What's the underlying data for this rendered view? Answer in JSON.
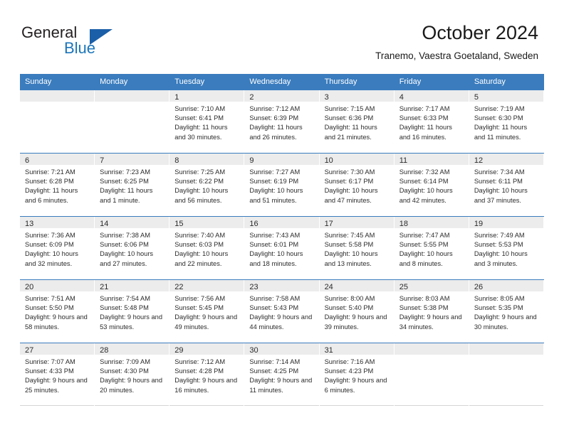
{
  "logo": {
    "primary_text": "General",
    "secondary_text": "Blue",
    "primary_color": "#231f20",
    "secondary_color": "#1b75bb",
    "triangle_color": "#1b5fa8",
    "triangle_icon": "triangle-icon"
  },
  "header": {
    "title": "October 2024",
    "subtitle": "Tranemo, Vaestra Goetaland, Sweden"
  },
  "theme": {
    "header_bg": "#3a7cbe",
    "header_text": "#ffffff",
    "day_band_bg": "#ececec",
    "row_divider": "#3a7cbe",
    "body_text": "#2b2b2b"
  },
  "weekdays": [
    "Sunday",
    "Monday",
    "Tuesday",
    "Wednesday",
    "Thursday",
    "Friday",
    "Saturday"
  ],
  "weeks": [
    [
      {
        "day": "",
        "empty": true
      },
      {
        "day": "",
        "empty": true
      },
      {
        "day": "1",
        "sunrise": "Sunrise: 7:10 AM",
        "sunset": "Sunset: 6:41 PM",
        "daylight": "Daylight: 11 hours and 30 minutes."
      },
      {
        "day": "2",
        "sunrise": "Sunrise: 7:12 AM",
        "sunset": "Sunset: 6:39 PM",
        "daylight": "Daylight: 11 hours and 26 minutes."
      },
      {
        "day": "3",
        "sunrise": "Sunrise: 7:15 AM",
        "sunset": "Sunset: 6:36 PM",
        "daylight": "Daylight: 11 hours and 21 minutes."
      },
      {
        "day": "4",
        "sunrise": "Sunrise: 7:17 AM",
        "sunset": "Sunset: 6:33 PM",
        "daylight": "Daylight: 11 hours and 16 minutes."
      },
      {
        "day": "5",
        "sunrise": "Sunrise: 7:19 AM",
        "sunset": "Sunset: 6:30 PM",
        "daylight": "Daylight: 11 hours and 11 minutes."
      }
    ],
    [
      {
        "day": "6",
        "sunrise": "Sunrise: 7:21 AM",
        "sunset": "Sunset: 6:28 PM",
        "daylight": "Daylight: 11 hours and 6 minutes."
      },
      {
        "day": "7",
        "sunrise": "Sunrise: 7:23 AM",
        "sunset": "Sunset: 6:25 PM",
        "daylight": "Daylight: 11 hours and 1 minute."
      },
      {
        "day": "8",
        "sunrise": "Sunrise: 7:25 AM",
        "sunset": "Sunset: 6:22 PM",
        "daylight": "Daylight: 10 hours and 56 minutes."
      },
      {
        "day": "9",
        "sunrise": "Sunrise: 7:27 AM",
        "sunset": "Sunset: 6:19 PM",
        "daylight": "Daylight: 10 hours and 51 minutes."
      },
      {
        "day": "10",
        "sunrise": "Sunrise: 7:30 AM",
        "sunset": "Sunset: 6:17 PM",
        "daylight": "Daylight: 10 hours and 47 minutes."
      },
      {
        "day": "11",
        "sunrise": "Sunrise: 7:32 AM",
        "sunset": "Sunset: 6:14 PM",
        "daylight": "Daylight: 10 hours and 42 minutes."
      },
      {
        "day": "12",
        "sunrise": "Sunrise: 7:34 AM",
        "sunset": "Sunset: 6:11 PM",
        "daylight": "Daylight: 10 hours and 37 minutes."
      }
    ],
    [
      {
        "day": "13",
        "sunrise": "Sunrise: 7:36 AM",
        "sunset": "Sunset: 6:09 PM",
        "daylight": "Daylight: 10 hours and 32 minutes."
      },
      {
        "day": "14",
        "sunrise": "Sunrise: 7:38 AM",
        "sunset": "Sunset: 6:06 PM",
        "daylight": "Daylight: 10 hours and 27 minutes."
      },
      {
        "day": "15",
        "sunrise": "Sunrise: 7:40 AM",
        "sunset": "Sunset: 6:03 PM",
        "daylight": "Daylight: 10 hours and 22 minutes."
      },
      {
        "day": "16",
        "sunrise": "Sunrise: 7:43 AM",
        "sunset": "Sunset: 6:01 PM",
        "daylight": "Daylight: 10 hours and 18 minutes."
      },
      {
        "day": "17",
        "sunrise": "Sunrise: 7:45 AM",
        "sunset": "Sunset: 5:58 PM",
        "daylight": "Daylight: 10 hours and 13 minutes."
      },
      {
        "day": "18",
        "sunrise": "Sunrise: 7:47 AM",
        "sunset": "Sunset: 5:55 PM",
        "daylight": "Daylight: 10 hours and 8 minutes."
      },
      {
        "day": "19",
        "sunrise": "Sunrise: 7:49 AM",
        "sunset": "Sunset: 5:53 PM",
        "daylight": "Daylight: 10 hours and 3 minutes."
      }
    ],
    [
      {
        "day": "20",
        "sunrise": "Sunrise: 7:51 AM",
        "sunset": "Sunset: 5:50 PM",
        "daylight": "Daylight: 9 hours and 58 minutes."
      },
      {
        "day": "21",
        "sunrise": "Sunrise: 7:54 AM",
        "sunset": "Sunset: 5:48 PM",
        "daylight": "Daylight: 9 hours and 53 minutes."
      },
      {
        "day": "22",
        "sunrise": "Sunrise: 7:56 AM",
        "sunset": "Sunset: 5:45 PM",
        "daylight": "Daylight: 9 hours and 49 minutes."
      },
      {
        "day": "23",
        "sunrise": "Sunrise: 7:58 AM",
        "sunset": "Sunset: 5:43 PM",
        "daylight": "Daylight: 9 hours and 44 minutes."
      },
      {
        "day": "24",
        "sunrise": "Sunrise: 8:00 AM",
        "sunset": "Sunset: 5:40 PM",
        "daylight": "Daylight: 9 hours and 39 minutes."
      },
      {
        "day": "25",
        "sunrise": "Sunrise: 8:03 AM",
        "sunset": "Sunset: 5:38 PM",
        "daylight": "Daylight: 9 hours and 34 minutes."
      },
      {
        "day": "26",
        "sunrise": "Sunrise: 8:05 AM",
        "sunset": "Sunset: 5:35 PM",
        "daylight": "Daylight: 9 hours and 30 minutes."
      }
    ],
    [
      {
        "day": "27",
        "sunrise": "Sunrise: 7:07 AM",
        "sunset": "Sunset: 4:33 PM",
        "daylight": "Daylight: 9 hours and 25 minutes."
      },
      {
        "day": "28",
        "sunrise": "Sunrise: 7:09 AM",
        "sunset": "Sunset: 4:30 PM",
        "daylight": "Daylight: 9 hours and 20 minutes."
      },
      {
        "day": "29",
        "sunrise": "Sunrise: 7:12 AM",
        "sunset": "Sunset: 4:28 PM",
        "daylight": "Daylight: 9 hours and 16 minutes."
      },
      {
        "day": "30",
        "sunrise": "Sunrise: 7:14 AM",
        "sunset": "Sunset: 4:25 PM",
        "daylight": "Daylight: 9 hours and 11 minutes."
      },
      {
        "day": "31",
        "sunrise": "Sunrise: 7:16 AM",
        "sunset": "Sunset: 4:23 PM",
        "daylight": "Daylight: 9 hours and 6 minutes."
      },
      {
        "day": "",
        "empty": true
      },
      {
        "day": "",
        "empty": true
      }
    ]
  ]
}
